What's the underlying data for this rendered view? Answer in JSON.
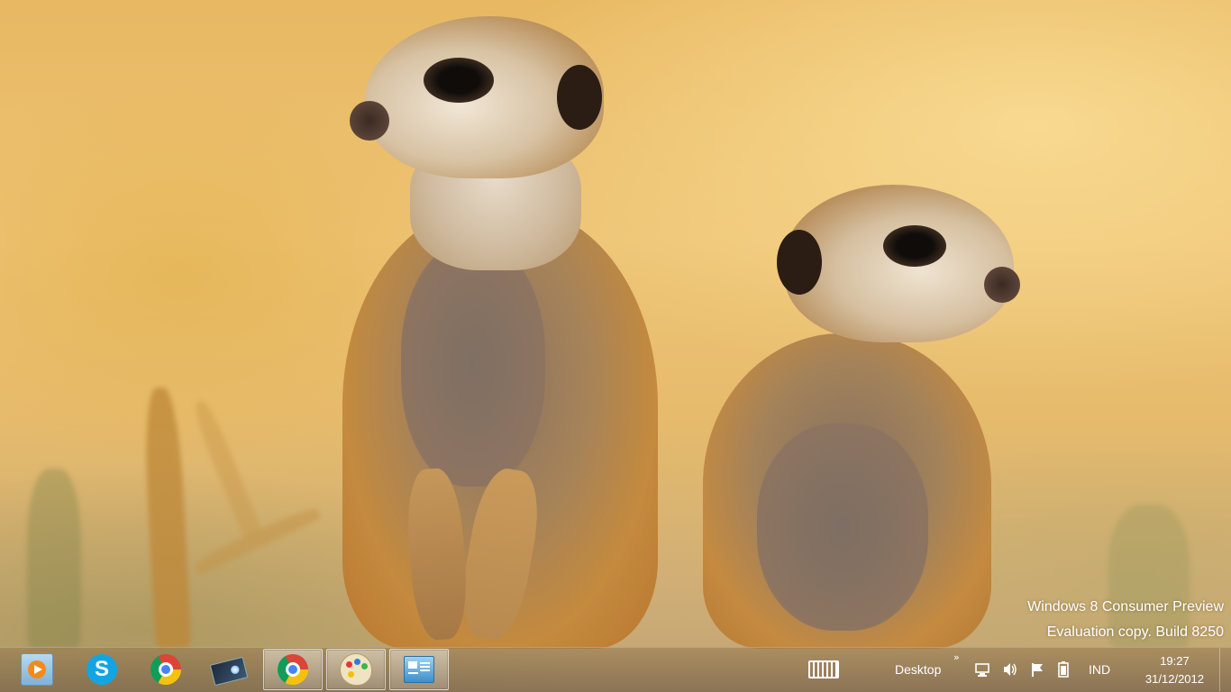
{
  "desktop": {
    "watermark_line1": "Windows 8 Consumer Preview",
    "watermark_line2": "Evaluation copy. Build 8250"
  },
  "taskbar": {
    "apps": [
      {
        "name": "media-player",
        "icon": "media-player-icon",
        "running": false
      },
      {
        "name": "skype",
        "icon": "skype-icon",
        "glyph": "S",
        "running": false
      },
      {
        "name": "chrome-pinned",
        "icon": "chrome-icon",
        "running": false
      },
      {
        "name": "card-tool",
        "icon": "card-icon",
        "running": false
      },
      {
        "name": "chrome-running",
        "icon": "chrome-icon",
        "running": true
      },
      {
        "name": "paint",
        "icon": "paint-palette-icon",
        "running": true
      },
      {
        "name": "system-panel",
        "icon": "control-panel-icon",
        "running": true
      }
    ],
    "toolbar_label": "Desktop",
    "toolbar_chevron": "»",
    "language": "IND",
    "clock_time": "19:27",
    "clock_date": "31/12/2012",
    "tray_icons": [
      "touch-keyboard-icon",
      "network-icon",
      "volume-icon",
      "action-center-flag-icon",
      "battery-icon"
    ]
  }
}
